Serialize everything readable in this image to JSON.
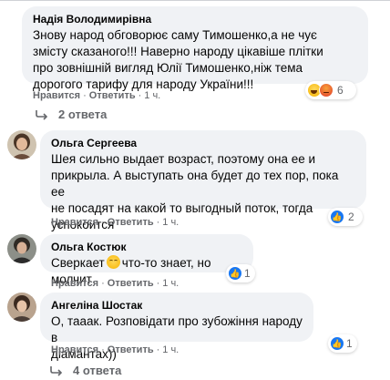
{
  "colors": {
    "bubble": "#f0f2f5",
    "meta": "#65676b",
    "like_blue": "#1877f2",
    "text": "#050505"
  },
  "comments": [
    {
      "author": "Надія Володимирівна",
      "text": "Знову народ обговорює саму Тимошенко,а не чує\nзмісту сказаного!!! Наверно народу цікавіше плітки\nпро зовнішній вигляд Юлії Тимошенко,ніж тема\nдорогого тарифу для народу України!!!",
      "like_label": "Нравится",
      "reply_label": "Ответить",
      "time": "1 ч.",
      "reactions": [
        "haha-icon",
        "angry-icon"
      ],
      "reaction_count": "6"
    },
    {
      "author": "Ольга Сергеева",
      "text": "Шея сильно выдает возраст, поэтому она ее и\nприкрыла. А выступать она будет до тех пор, пока ее\nне посадят на какой то выгодный поток, тогда\nуспокоится",
      "like_label": "Нравится",
      "reply_label": "Ответить",
      "time": "1 ч.",
      "reactions": [
        "like-icon"
      ],
      "reaction_count": "2"
    },
    {
      "author": "Ольга Костюк",
      "text_before": "Сверкает",
      "emoji": "grinning-face-icon",
      "text_after": "что-то знает, но молчит",
      "like_label": "Нравится",
      "reply_label": "Ответить",
      "time": "1 ч.",
      "reactions": [
        "like-icon"
      ],
      "reaction_count": "1"
    },
    {
      "author": "Ангеліна Шостак",
      "text": "О, тааак. Розповідати про зубожіння народу в\nдіамантах))",
      "like_label": "Нравится",
      "reply_label": "Ответить",
      "time": "1 ч.",
      "reactions": [
        "like-icon"
      ],
      "reaction_count": "1"
    }
  ],
  "reply_threads": [
    {
      "label": "2 ответа"
    },
    {
      "label": "4 ответа"
    }
  ]
}
